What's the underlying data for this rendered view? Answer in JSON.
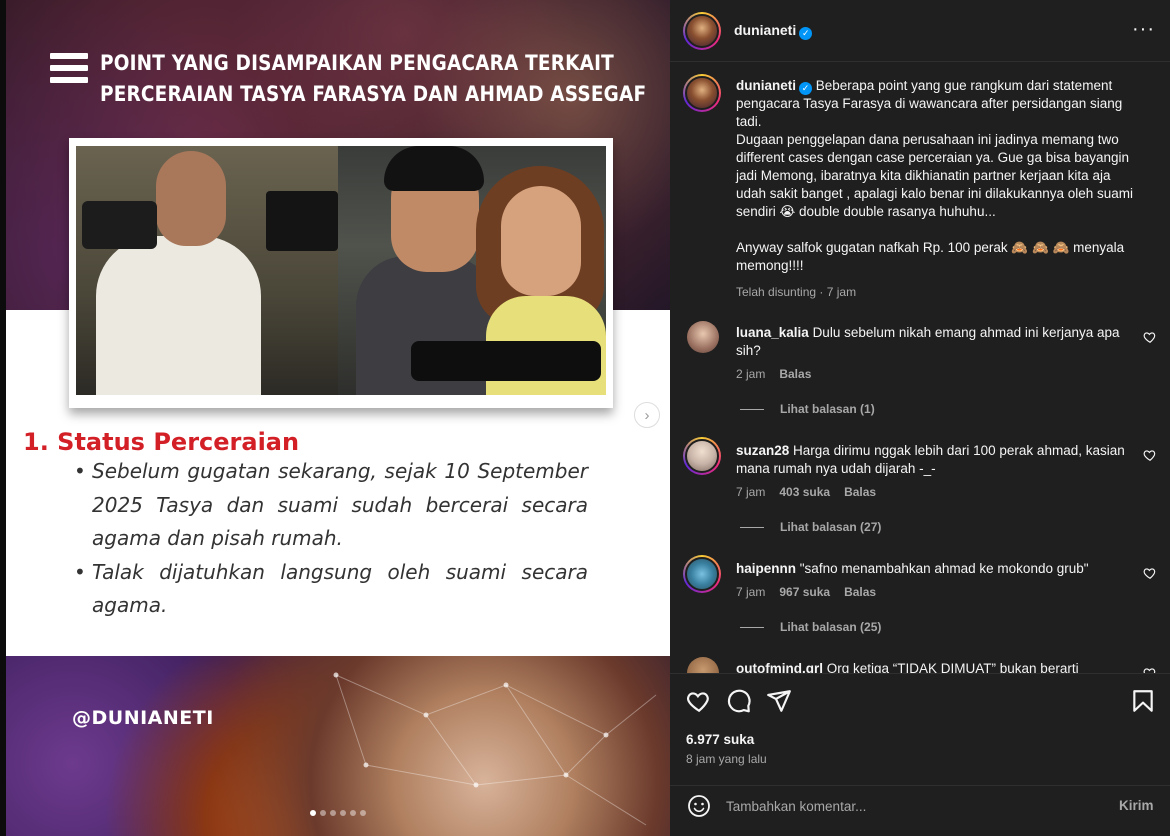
{
  "post": {
    "card_title_line1": "POINT YANG DISAMPAIKAN PENGACARA TERKAIT",
    "card_title_line2": "PERCERAIAN TASYA FARASYA DAN AHMAD ASSEGAF",
    "section_heading": "1. Status Perceraian",
    "bullets": [
      "Sebelum gugatan sekarang, sejak 10 September 2025 Tasya dan suami sudah bercerai secara agama dan pisah rumah.",
      "Talak dijatuhkan langsung oleh suami secara agama."
    ],
    "watermark": "@DUNIANETI",
    "carousel_total": 6,
    "carousel_active": 1
  },
  "header": {
    "username": "dunianeti",
    "verified_icon": "verified-badge-icon",
    "more_icon": "more-options-icon"
  },
  "caption": {
    "username": "dunianeti",
    "paragraph1": "Beberapa point yang gue rangkum dari statement pengacara Tasya Farasya di wawancara after persidangan siang tadi.",
    "paragraph2": "Dugaan penggelapan dana perusahaan ini jadinya memang two different cases dengan case perceraian ya. Gue ga bisa bayangin jadi Memong, ibaratnya kita dikhianatin partner kerjaan kita aja udah sakit banget , apalagi kalo benar ini dilakukannya oleh suami sendiri 😭 double double rasanya huhuhu...",
    "paragraph3": "Anyway salfok gugatan nafkah Rp. 100 perak 🙈 🙈 🙈 menyala memong!!!!",
    "meta": "Telah disunting · 7 jam"
  },
  "comments": [
    {
      "username": "luana_kalia",
      "text": "Dulu sebelum nikah emang ahmad ini kerjanya apa sih?",
      "time": "2 jam",
      "likes": "",
      "reply": "Balas",
      "view_replies": "Lihat balasan (1)"
    },
    {
      "username": "suzan28",
      "text": "Harga dirimu nggak lebih dari 100 perak ahmad, kasian mana rumah nya udah dijarah -_-",
      "time": "7 jam",
      "likes": "403 suka",
      "reply": "Balas",
      "view_replies": "Lihat balasan (27)"
    },
    {
      "username": "haipennn",
      "text": "\"safno menambahkan ahmad ke mokondo grub\"",
      "time": "7 jam",
      "likes": "967 suka",
      "reply": "Balas",
      "view_replies": "Lihat balasan (25)"
    },
    {
      "username": "outofmind.grl",
      "text": "Org ketiga “TIDAK DIMUAT” bukan berarti",
      "time": "",
      "likes": "",
      "reply": "",
      "view_replies": ""
    }
  ],
  "actions": {
    "likes": "6.977 suka",
    "time": "8 jam yang lalu",
    "icons": [
      "heart-icon",
      "comment-icon",
      "share-icon",
      "bookmark-icon"
    ]
  },
  "comment_bar": {
    "placeholder": "Tambahkan komentar...",
    "post_label": "Kirim",
    "emoji_icon": "emoji-icon"
  }
}
